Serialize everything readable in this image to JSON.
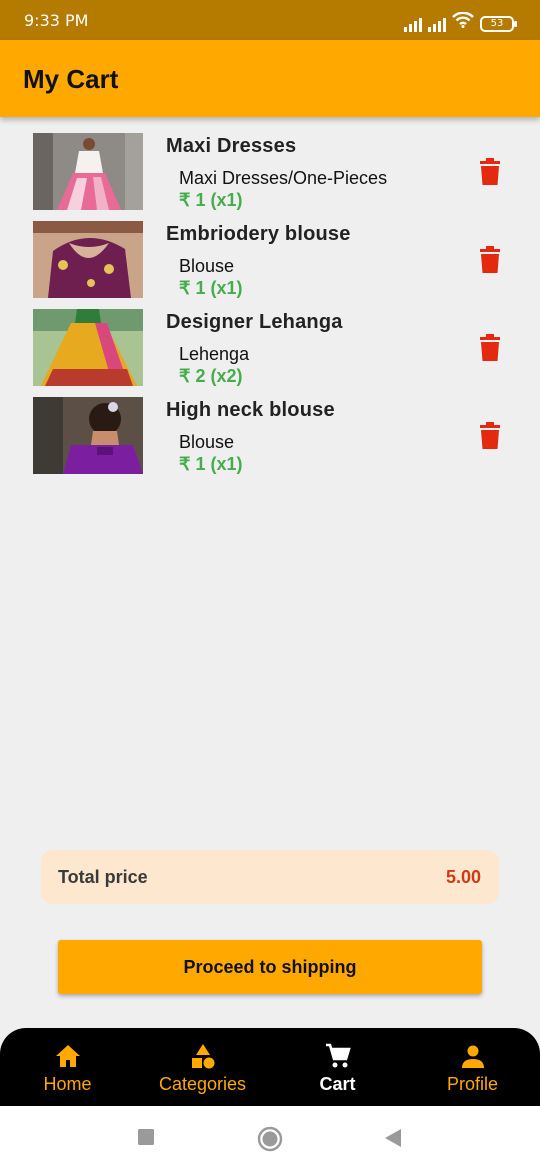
{
  "status_bar": {
    "time": "9:33 PM",
    "battery": "53"
  },
  "header": {
    "title": "My Cart"
  },
  "cart": {
    "items": [
      {
        "name": "Maxi Dresses",
        "category": "Maxi Dresses/One-Pieces",
        "price": "₹ 1 (x1)"
      },
      {
        "name": "Embriodery blouse",
        "category": "Blouse",
        "price": "₹ 1 (x1)"
      },
      {
        "name": "Designer Lehanga",
        "category": "Lehenga",
        "price": "₹ 2 (x2)"
      },
      {
        "name": "High neck blouse",
        "category": "Blouse",
        "price": "₹ 1 (x1)"
      }
    ]
  },
  "total": {
    "label": "Total price",
    "value": "5.00"
  },
  "proceed_button": {
    "label": "Proceed to shipping"
  },
  "bottom_nav": {
    "items": [
      {
        "label": "Home",
        "icon": "home-icon"
      },
      {
        "label": "Categories",
        "icon": "categories-icon"
      },
      {
        "label": "Cart",
        "icon": "cart-icon",
        "active": true
      },
      {
        "label": "Profile",
        "icon": "profile-icon"
      }
    ]
  },
  "colors": {
    "accent": "#ffa800",
    "status_bar": "#b57a00",
    "price_green": "#45ad4d",
    "delete_red": "#e3290f",
    "total_bg": "#fde7cf",
    "total_value": "#cf3b17"
  }
}
